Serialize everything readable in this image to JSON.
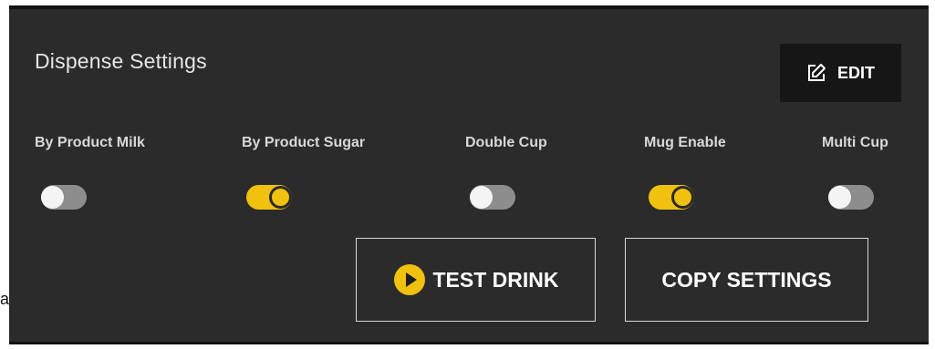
{
  "stray_text": "a",
  "panel": {
    "title": "Dispense Settings",
    "edit_label": "EDIT"
  },
  "toggles": [
    {
      "label": "By Product Milk",
      "on": false
    },
    {
      "label": "By Product Sugar",
      "on": true
    },
    {
      "label": "Double Cup",
      "on": false
    },
    {
      "label": "Mug Enable",
      "on": true
    },
    {
      "label": "Multi Cup",
      "on": false
    }
  ],
  "actions": {
    "test_drink_label": "TEST DRINK",
    "copy_settings_label": "COPY SETTINGS"
  },
  "icons": {
    "edit": "edit-icon",
    "play": "play-icon"
  },
  "colors": {
    "background": "#2b2b2b",
    "accent": "#f1c10f",
    "toggle_off": "#8d8d8d"
  }
}
